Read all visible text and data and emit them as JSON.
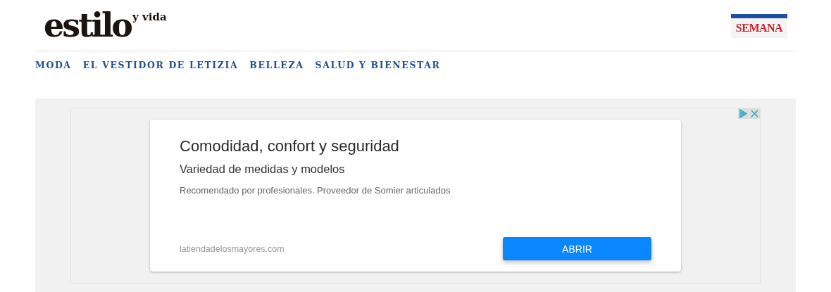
{
  "header": {
    "logo": {
      "main": "estilo",
      "accent": "y vida"
    },
    "partner_logo": "SEMANA"
  },
  "nav": [
    {
      "label": "MODA"
    },
    {
      "label": "EL VESTIDOR DE LETIZIA"
    },
    {
      "label": "BELLEZA"
    },
    {
      "label": "SALUD Y BIENESTAR"
    }
  ],
  "ad": {
    "title": "Comodidad, confort y seguridad",
    "subtitle": "Variedad de medidas y modelos",
    "description": "Recomendado por profesionales. Proveedor de Somier articulados",
    "domain": "latiendadelosmayores.com",
    "button": "ABRIR"
  }
}
